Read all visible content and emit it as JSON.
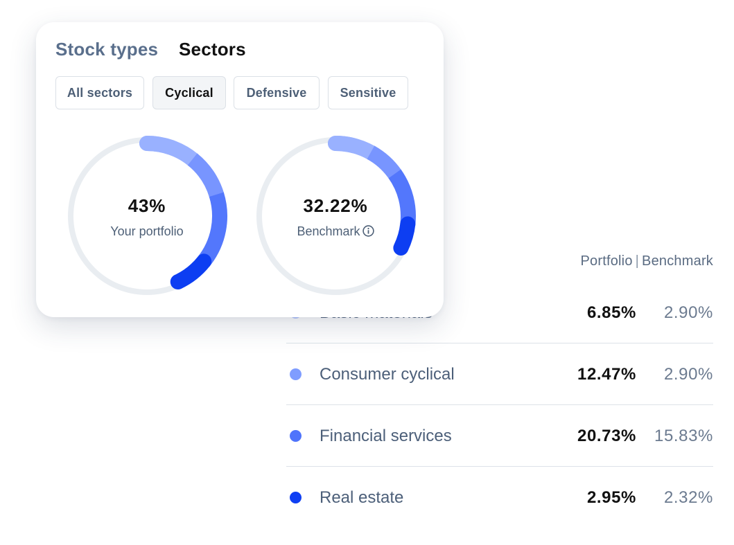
{
  "tabs": {
    "stock_types": "Stock types",
    "sectors": "Sectors"
  },
  "filters": {
    "all": "All sectors",
    "cyclical": "Cyclical",
    "defensive": "Defensive",
    "sensitive": "Sensitive",
    "selected": "Cyclical"
  },
  "donuts": {
    "portfolio": {
      "value": "43%",
      "label": "Your portfolio",
      "fraction": 0.43
    },
    "benchmark": {
      "value": "32.22%",
      "label": "Benchmark",
      "fraction": 0.3222
    }
  },
  "table": {
    "header_portfolio": "Portfolio",
    "header_separator": "|",
    "header_benchmark": "Benchmark",
    "rows": [
      {
        "name": "Basic materials",
        "portfolio": "6.85%",
        "benchmark": "2.90%",
        "color": "#b6c8ff"
      },
      {
        "name": "Consumer cyclical",
        "portfolio": "12.47%",
        "benchmark": "2.90%",
        "color": "#7f9dff"
      },
      {
        "name": "Financial services",
        "portfolio": "20.73%",
        "benchmark": "15.83%",
        "color": "#4f74fb"
      },
      {
        "name": "Real estate",
        "portfolio": "2.95%",
        "benchmark": "2.32%",
        "color": "#0f3ff3"
      }
    ]
  },
  "colors": {
    "track": "#e9edf1",
    "segment_1": "#99b1ff",
    "segment_2": "#7895ff",
    "segment_3": "#5377fc",
    "segment_4": "#0d3ef2"
  },
  "icons": {
    "benchmark_info": "info-icon"
  }
}
